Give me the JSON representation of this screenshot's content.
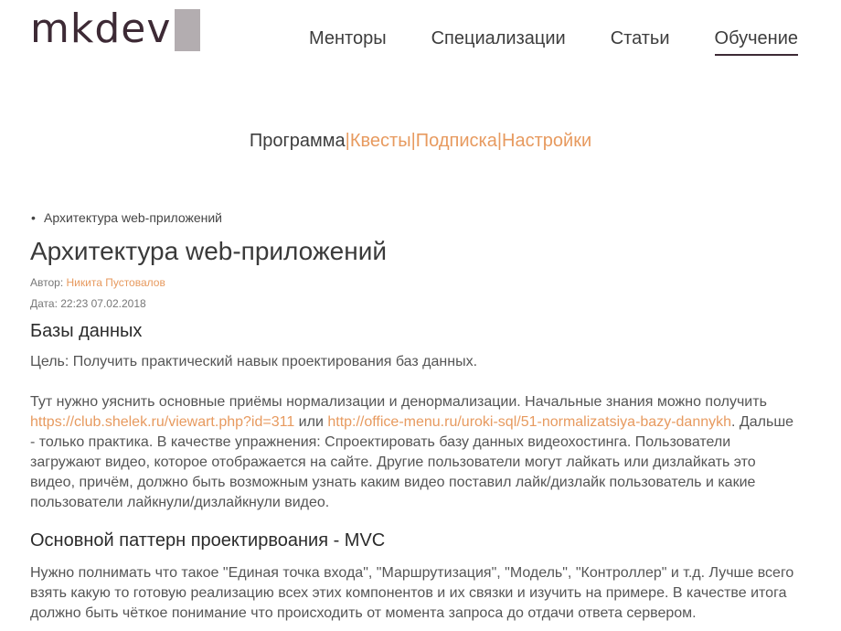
{
  "logo": {
    "text": "mkdev"
  },
  "nav": {
    "items": [
      {
        "label": "Менторы"
      },
      {
        "label": "Специализации"
      },
      {
        "label": "Статьи"
      },
      {
        "label": "Обучение",
        "active": true
      }
    ]
  },
  "subnav": {
    "items": [
      {
        "label": "Программа",
        "current": true
      },
      {
        "label": "Квесты"
      },
      {
        "label": "Подписка"
      },
      {
        "label": "Настройки"
      }
    ],
    "separator": "|"
  },
  "breadcrumb": {
    "bullet": "•",
    "label": "Архитектура web-приложений"
  },
  "article": {
    "title": "Архитектура web-приложений",
    "author_prefix": "Автор:",
    "author_name": "Никита Пустовалов",
    "date": "Дата: 22:23 07.02.2018",
    "section1_title": "Базы данных",
    "goal": "Цель: Получить практический навык проектирования баз данных.",
    "para1_start": "Тут нужно уяснить основные приёмы нормализации и денормализации. Начальные знания можно получить",
    "link1": "https://club.shelek.ru/viewart.php?id=311",
    "or": "или",
    "link2": "http://office-menu.ru/uroki-sql/51-normalizatsiya-bazy-dannykh",
    "para1_end": ". Дальше - только практика. В качестве упражнения: Спроектировать базу данных видеохостинга. Пользователи загружают видео, которое отображается на сайте. Другие пользователи могут лайкать или дизлайкать это видео, причём, должно быть возможным узнать каким видео поставил лайк/дизлайк пользователь и какие пользователи лайкнули/дизлайкнули видео.",
    "section2_title": "Основной паттерн проектирвоания - MVC",
    "para2": "Нужно полнимать что такое \"Единая точка входа\", \"Маршрутизация\", \"Модель\", \"Контроллер\" и т.д. Лучше всего взять какую то готовую реализацию всех этих компонентов и их связки и изучить на примере. В качестве итога должно быть чёткое понимание что происходить от момента запроса до отдачи ответа сервером."
  },
  "colors": {
    "accent": "#e79a5f",
    "brand": "#3d2a35",
    "logo_block": "#b3adb0"
  }
}
